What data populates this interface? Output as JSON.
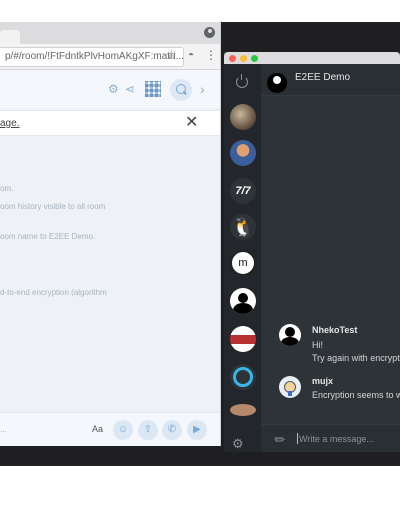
{
  "browser": {
    "url": "p/#/room/!FtFdntkPlvHomAKgXF:matri...",
    "notice": "age.",
    "events": [
      "om.",
      "oom history visible to all room",
      "oom name to E2EE Demo.",
      "d-to-end encryption (algorithm"
    ],
    "composer_placeholder": "...",
    "format_label": "Aa"
  },
  "app": {
    "room_title": "E2EE Demo",
    "rail_logo_text": "m",
    "messages": [
      {
        "sender": "NhekoTest",
        "lines": [
          "Hi!",
          "Try again with encrypt"
        ]
      },
      {
        "sender": "mujx",
        "lines": [
          "Encryption seems to w"
        ]
      }
    ],
    "input_placeholder": "Write a message..."
  },
  "colors": {
    "accent": "#76a9da",
    "chat_bg": "#2e3338",
    "rail_bg": "#23272b",
    "close_red": "#fe5f57",
    "minimize_yellow": "#febc2e",
    "maximize_green": "#28c840"
  }
}
